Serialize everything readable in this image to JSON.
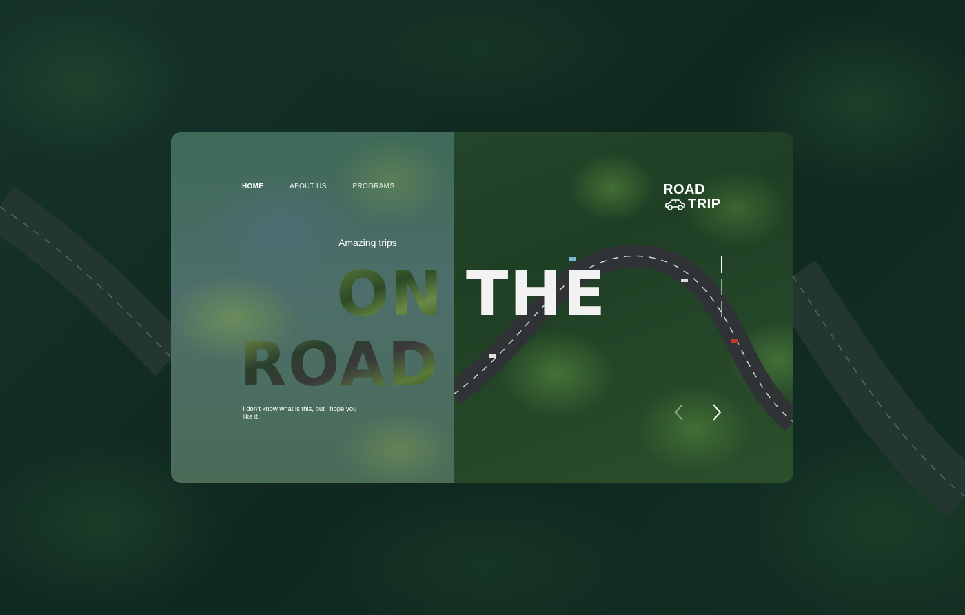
{
  "nav": {
    "items": [
      {
        "label": "HOME",
        "active": true
      },
      {
        "label": "ABOUT US",
        "active": false
      },
      {
        "label": "PROGRAMS",
        "active": false
      }
    ]
  },
  "hero": {
    "subtitle": "Amazing trips",
    "word_on": "ON",
    "word_the": "THE",
    "word_road": "ROAD",
    "description": "I don’t know what is this, but i hope you like it."
  },
  "logo": {
    "line1": "ROAD",
    "line2": "TRIP",
    "icon": "car-icon"
  },
  "slider": {
    "prev_icon": "chevron-left-icon",
    "next_icon": "chevron-right-icon"
  },
  "colors": {
    "accent": "#ffffff",
    "background": "#0f2a1f",
    "glass": "#4d6e6a"
  }
}
